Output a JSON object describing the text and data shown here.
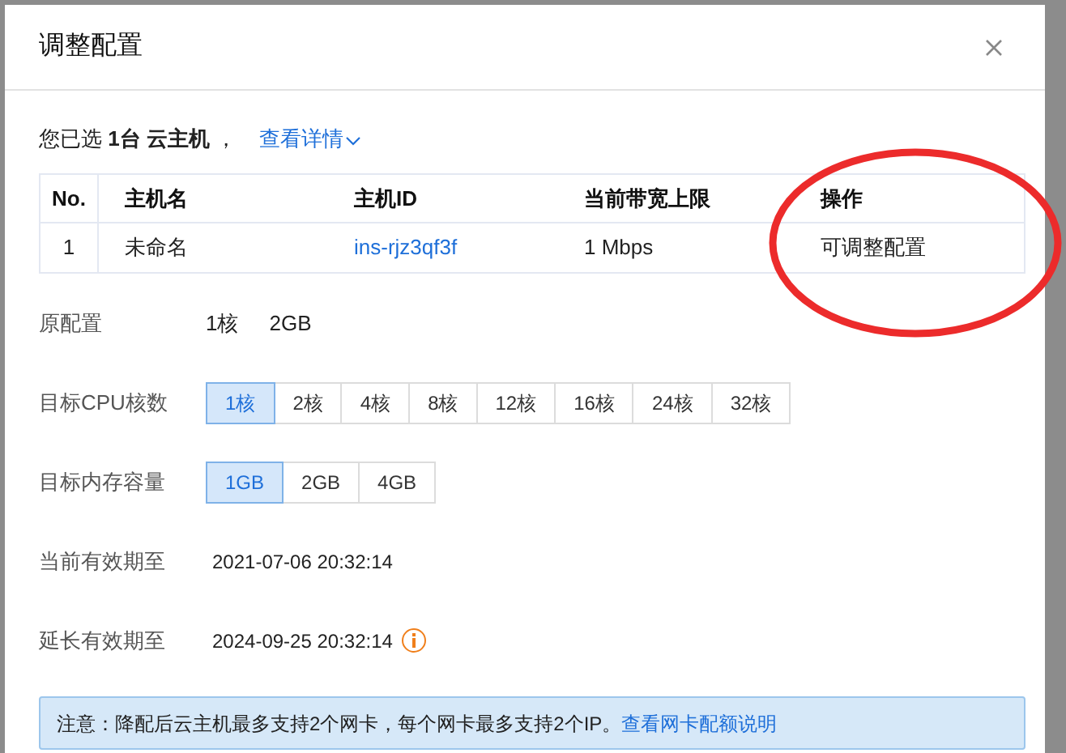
{
  "dialog": {
    "title": "调整配置"
  },
  "summary": {
    "text": "您已选 **1台 云主机** ，",
    "link": "查看详情"
  },
  "table": {
    "columns": [
      {
        "label": "No.",
        "kind": "center"
      },
      {
        "label": "主机名",
        "kind": "text"
      },
      {
        "label": "主机ID",
        "kind": "link"
      },
      {
        "label": "当前带宽上限",
        "kind": "text"
      },
      {
        "label": "操作",
        "kind": "text"
      }
    ],
    "rows": [
      {
        "cells": [
          "1",
          "未命名",
          "ins-rjz3qf3f",
          "1 Mbps",
          "可调整配置"
        ]
      }
    ]
  },
  "fields": [
    {
      "kind": "values",
      "label": "原配置",
      "values": [
        "1核",
        "2GB"
      ]
    },
    {
      "kind": "options",
      "label": "目标CPU核数",
      "options": [
        {
          "label": "1核",
          "selected": true
        },
        {
          "label": "2核",
          "selected": false
        },
        {
          "label": "4核",
          "selected": false
        },
        {
          "label": "8核",
          "selected": false
        },
        {
          "label": "12核",
          "selected": false
        },
        {
          "label": "16核",
          "selected": false
        },
        {
          "label": "24核",
          "selected": false
        },
        {
          "label": "32核",
          "selected": false
        }
      ]
    },
    {
      "kind": "options",
      "label": "目标内存容量",
      "options": [
        {
          "label": "1GB",
          "selected": true
        },
        {
          "label": "2GB",
          "selected": false
        },
        {
          "label": "4GB",
          "selected": false
        }
      ]
    },
    {
      "kind": "date",
      "label": "当前有效期至",
      "value": "2021-07-06 20:32:14",
      "info": false
    },
    {
      "kind": "date",
      "label": "延长有效期至",
      "value": "2024-09-25 20:32:14",
      "info": true
    }
  ],
  "notice": {
    "text": "注意：降配后云主机最多支持2个网卡，每个网卡最多支持2个IP。",
    "link": "查看网卡配额说明"
  },
  "annotation": {
    "kind": "ellipse"
  }
}
